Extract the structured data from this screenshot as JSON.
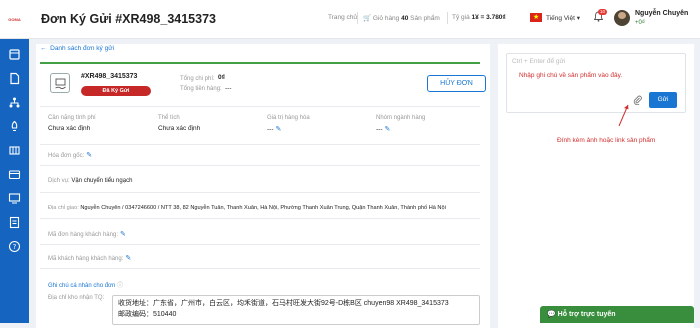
{
  "brand": {
    "logo_text": "GOMA"
  },
  "header": {
    "title": "Đơn Ký Gửi #XR498_3415373",
    "home": "Trang chủ",
    "cart_label": "Giỏ hàng",
    "cart_count": "40",
    "cart_unit": "Sản phẩm",
    "rate_label": "Tỷ giá",
    "rate_value": "1¥ = 3.780₫",
    "language": "Tiếng Việt",
    "notif_count": "10",
    "user_name": "Nguyễn Chuyên",
    "user_balance": "+0₫"
  },
  "main": {
    "back_link": "Danh sách đơn ký gửi",
    "order_code": "#XR498_3415373",
    "status": "Đã Ký Gửi",
    "total_fee_label": "Tổng chi phí:",
    "total_fee_value": "0₫",
    "total_goods_label": "Tổng tiền hàng:",
    "total_goods_value": "---",
    "cancel_button": "HỦY ĐƠN",
    "weight_label": "Cân nặng tính phí",
    "weight_value": "Chưa xác định",
    "volume_label": "Thể tích",
    "volume_value": "Chưa xác định",
    "goods_value_label": "Giá trị hàng hóa",
    "goods_value": "---",
    "category_label": "Nhóm ngành hàng",
    "category_value": "---",
    "invoice_label": "Hóa đơn gốc:",
    "service_label": "Dịch vụ:",
    "service_value": "Vận chuyển tiểu ngạch",
    "delivery_label": "Địa chỉ giao:",
    "delivery_value": "Nguyễn Chuyên / 0347246600 / NTT 38, 82 Nguyễn Tuân, Thanh Xuân, Hà Nội, Phường Thanh Xuân Trung, Quận Thanh Xuân, Thành phố Hà Nội",
    "customer_order_label": "Mã đơn hàng khách hàng:",
    "customer_code_label": "Mã khách hàng khách hàng:",
    "note_section": "Ghi chú cá nhân cho đơn",
    "cn_address_label": "Địa chỉ kho nhận TQ:",
    "cn_address_line1": "收货地址：广东省，广州市，白云区，均禾街道，石马村旺发大街92号-D栋B区 chuyen98 XR498_3415373",
    "cn_address_line2": "邮政编码：510440"
  },
  "notes": {
    "placeholder": "Ctrl + Enter để gửi",
    "hint": "Nhập ghi chú về sản phẩm vào đây.",
    "send_button": "Gửi",
    "attach_hint": "Đính kèm ảnh hoặc link sản phẩm"
  },
  "support": {
    "label": "Hỗ trợ trực tuyến"
  },
  "colors": {
    "primary": "#1976d2",
    "sidebar": "#1565c0",
    "danger": "#c62828",
    "accent_green": "#43a047"
  }
}
